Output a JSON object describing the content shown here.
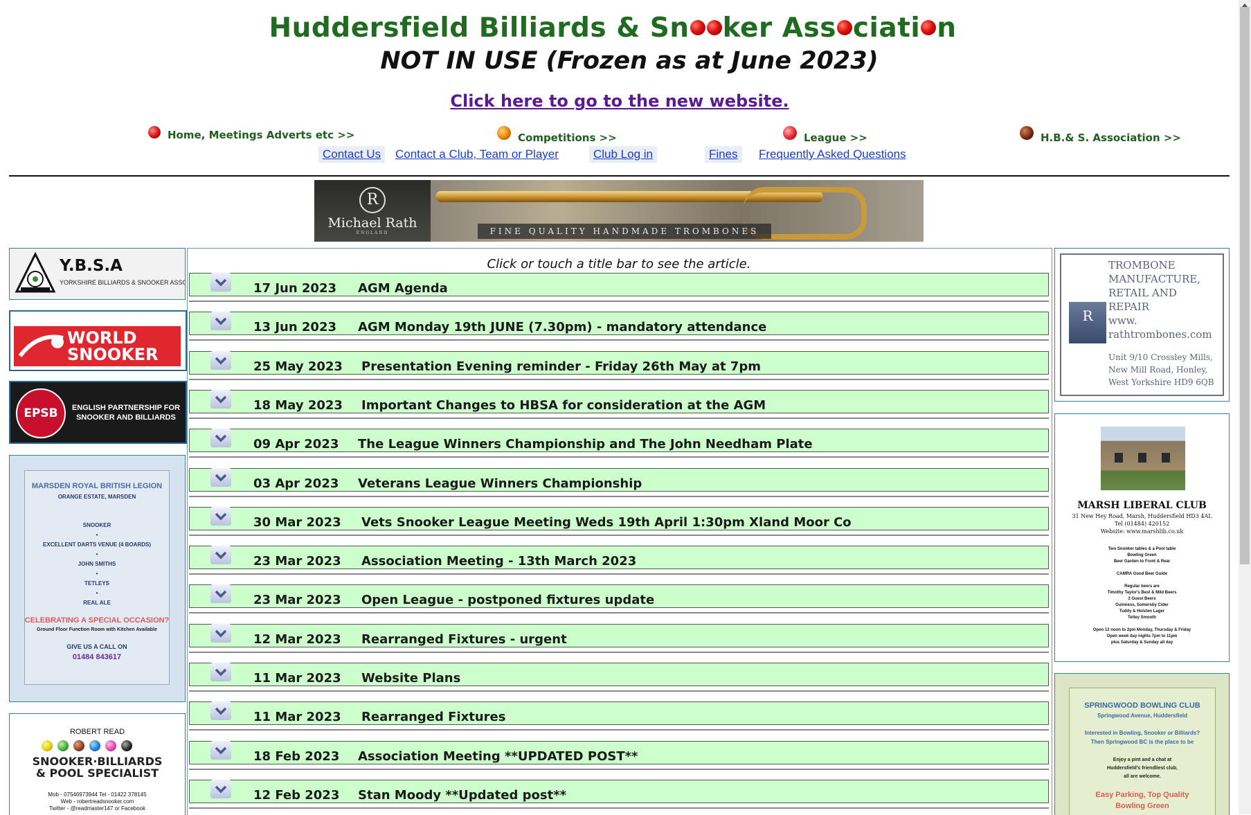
{
  "header": {
    "title_part1": "Huddersfield Billiards & Sn",
    "title_part2": "ker Ass",
    "title_part3": "ciati",
    "title_part4": "n",
    "frozen_notice": "NOT IN USE (Frozen as at June 2023)",
    "new_site_link": "Click here to go to the new website."
  },
  "nav": [
    {
      "label": "Home, Meetings Adverts etc >>",
      "ball_color": "#d81b1b"
    },
    {
      "label": "Competitions >>",
      "ball_color": "#f0880a"
    },
    {
      "label": "League >>",
      "ball_color": "#e8303a"
    },
    {
      "label": "H.B.& S. Association >>",
      "ball_color": "#7a2a12"
    }
  ],
  "links": {
    "contact_us": "Contact Us",
    "contact_club": "Contact a Club, Team or Player",
    "club_login": "Club Log in",
    "fines": "Fines",
    "faq": "Frequently Asked Questions"
  },
  "banner": {
    "brand": "Michael Rath",
    "brand_sub": "ENGLAND",
    "tagline": "FINE QUALITY HANDMADE TROMBONES",
    "mark": "R"
  },
  "left_ads": {
    "ybsa_title": "Y.B.S.A",
    "ybsa_sub": "YORKSHIRE BILLIARDS & SNOOKER ASSOCIATION",
    "world_snooker_line1": "WORLD",
    "world_snooker_line2": "SNOOKER",
    "epsb_badge": "EPSB",
    "epsb_line1": "ENGLISH PARTNERSHIP FOR",
    "epsb_line2": "SNOOKER AND BILLIARDS",
    "marsden_title": "MARSDEN ROYAL BRITISH LEGION",
    "marsden_sub": "ORANGE ESTATE, MARSDEN",
    "marsden_items": [
      "SNOOKER",
      "EXCELLENT DARTS VENUE (4 BOARDS)",
      "JOHN SMITHS",
      "TETLEYS",
      "REAL ALE"
    ],
    "marsden_celebrate": "CELEBRATING A SPECIAL OCCASION?",
    "marsden_room": "Ground Floor Function Room with Kitchen Available",
    "marsden_call": "GIVE US A CALL ON",
    "marsden_phone": "01484 843617",
    "robert_name": "ROBERT READ",
    "robert_line1": "SNOOKER·BILLIARDS",
    "robert_line2": "& POOL SPECIALIST",
    "robert_contact1": "Mob - 07546973944  Tel - 01422 378145",
    "robert_contact2": "Web - robertreadsnooker.com",
    "robert_contact3": "Twitter - @readmaster147 or Facebook"
  },
  "right_ads": {
    "rath_lines": [
      "TROMBONE",
      "MANUFACTURE,",
      "RETAIL AND",
      "REPAIR"
    ],
    "rath_www": "www.",
    "rath_domain": "rathtrombones.com",
    "rath_address": [
      "Unit 9/10 Crossley Mills,",
      "New Mill Road, Honley,",
      "West Yorkshire HD9 6QB"
    ],
    "marsh_title": "MARSH LIBERAL CLUB",
    "marsh_address": "31 New Hey Road, Marsh, Huddersfield HD3 4AL",
    "marsh_tel": "Tel (01484) 420152",
    "marsh_web": "Website: www.marshlib.co.uk",
    "marsh_features": [
      "Two Snooker tables & a Pool table",
      "Bowling Green",
      "Beer Garden to Front & Rear"
    ],
    "marsh_camra": "CAMRA Good Beer Guide",
    "marsh_beers": [
      "Regular beers are",
      "Timothy Taylor's Best & Mild Beers",
      "3 Guest Beers",
      "Guinness, Somersby Cider",
      "Tuddy & Holsten Lager",
      "Tetley Smooth"
    ],
    "marsh_hours": [
      "Open 12 noon to 2pm Monday, Thursday & Friday",
      "Open week day nights 7pm to 11pm",
      "plus Saturday & Sunday all day"
    ],
    "spring_title": "SPRINGWOOD BOWLING CLUB",
    "spring_sub": "Springwood Avenue, Huddersfield",
    "spring_q1": "Interested in Bowling, Snooker or Billiards?",
    "spring_q2": "Then Springwood BC is the place to be",
    "spring_t1": "Enjoy a pint and a chat at",
    "spring_t2": "Huddersfield's friendliest club,",
    "spring_t3": "all are welcome.",
    "spring_p1": "Easy Parking, Top Quality",
    "spring_p2": "Bowling Green"
  },
  "main": {
    "instruction": "Click or touch a title bar to see the article.",
    "articles": [
      {
        "date": "17 Jun 2023",
        "title": "AGM Agenda"
      },
      {
        "date": "13 Jun 2023",
        "title": "AGM Monday 19th JUNE (7.30pm) - mandatory attendance"
      },
      {
        "date": "25 May 2023",
        "title": "Presentation Evening reminder - Friday 26th May at 7pm"
      },
      {
        "date": "18 May 2023",
        "title": "Important Changes to HBSA for consideration at the AGM"
      },
      {
        "date": "09 Apr 2023",
        "title": "The League Winners Championship and The John Needham Plate"
      },
      {
        "date": "03 Apr 2023",
        "title": "Veterans League Winners Championship"
      },
      {
        "date": "30 Mar 2023",
        "title": "Vets Snooker League Meeting Weds 19th April 1:30pm Xland Moor Co"
      },
      {
        "date": "23 Mar 2023",
        "title": "Association Meeting - 13th March 2023"
      },
      {
        "date": "23 Mar 2023",
        "title": "Open League - postponed fixtures update"
      },
      {
        "date": "12 Mar 2023",
        "title": "Rearranged Fixtures - urgent"
      },
      {
        "date": "11 Mar 2023",
        "title": "Website Plans"
      },
      {
        "date": "11 Mar 2023",
        "title": "Rearranged Fixtures"
      },
      {
        "date": "18 Feb 2023",
        "title": "Association Meeting **UPDATED POST**"
      },
      {
        "date": "12 Feb 2023",
        "title": "Stan Moody **Updated post**"
      }
    ]
  }
}
